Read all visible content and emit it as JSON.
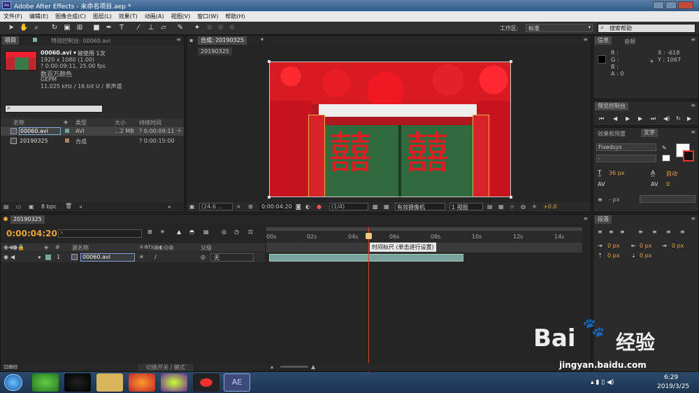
{
  "app": {
    "title": "Adobe After Effects - 未命名项目.aep *"
  },
  "menu": [
    "文件(F)",
    "编辑(E)",
    "图像合成(C)",
    "图层(L)",
    "效果(T)",
    "动画(A)",
    "视图(V)",
    "窗口(W)",
    "帮助(H)"
  ],
  "workspace": {
    "label": "工作区:",
    "value": "标准"
  },
  "search_help": {
    "placeholder": "搜索帮助"
  },
  "project": {
    "tab": "项目",
    "tab2": "特效控制台: 00060.avi",
    "file_name": "00060.avi ▾",
    "usage": "被使用 1次",
    "info": [
      "1920 x 1080 (1.00)",
      "? 0:00:09:11, 25.00 fps",
      "数百万颜色",
      "GEPM",
      "11.025 kHz / 16 bit U / 单声道"
    ],
    "columns": {
      "name": "名称",
      "type": "类型",
      "size": "大小",
      "duration": "持续时间"
    },
    "items": [
      {
        "name": "00060.avi",
        "type": "AVI",
        "size": "...2 MB",
        "duration": "? 0:00:09:11",
        "color": "#6fa8a0"
      },
      {
        "name": "20190325",
        "type": "合成",
        "size": "",
        "duration": "? 0:00:15:00",
        "color": "#b08060"
      }
    ],
    "bpc": "8 bpc"
  },
  "comp": {
    "tab": "合成: 20190325",
    "sub_tab": "20190325",
    "zoom": "(24.6 ...",
    "time": "0:00:04:20",
    "res": "(1/4)",
    "camera": "有效摄像机",
    "views": "1 视图",
    "exposure": "+0.0",
    "fu_left": "囍",
    "fu_right": "囍"
  },
  "info": {
    "tab": "信息",
    "tab2": "音频",
    "r": "R :",
    "g": "G :",
    "b": "B :",
    "a": "A : 0",
    "x": "X : -618",
    "y": "Y : 1067"
  },
  "preview": {
    "tab": "预览控制台"
  },
  "effects": {
    "tab": "效果和预置",
    "tab2": "文字"
  },
  "text": {
    "font": "Fixedsys",
    "style": "-",
    "size": "36 px",
    "leading": "自动",
    "kerning": "",
    "tracking": "0",
    "px": "- px"
  },
  "paragraph": {
    "tab": "段落",
    "v1": "0 px",
    "v2": "0 px",
    "v3": "0 px",
    "v4": "0 px",
    "v5": "0 px"
  },
  "timeline": {
    "tab": "20190325",
    "timecode": "0:00:04:20",
    "col_source": "源名称",
    "col_parent": "父级",
    "layer": {
      "num": "1",
      "name": "00060.avi",
      "parent": "无"
    },
    "ruler": [
      "00s",
      "02s",
      "04s",
      "06s",
      "08s",
      "10s",
      "12s",
      "14s"
    ],
    "tooltip": "时间标尺 (单击进行设置)",
    "switch_label": "切换开关 / 模式"
  },
  "watermark": {
    "brand": "Bai",
    "brand2": "经验",
    "url": "jingyan.baidu.com"
  },
  "taskbar": {
    "time": "6:29",
    "date": "2019/3/25"
  }
}
